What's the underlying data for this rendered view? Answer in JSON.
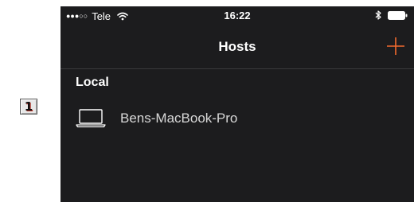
{
  "annotation": {
    "step_number": "1"
  },
  "status_bar": {
    "carrier": "Tele",
    "signal_dots": "●●●○○",
    "time": "16:22",
    "icons": [
      "wifi-icon",
      "bluetooth-icon",
      "battery-icon"
    ]
  },
  "nav": {
    "title": "Hosts",
    "add_icon": "plus-icon"
  },
  "sections": [
    {
      "header": "Local",
      "items": [
        {
          "icon": "laptop-icon",
          "label": "Bens-MacBook-Pro"
        }
      ]
    }
  ],
  "colors": {
    "background": "#1c1c1e",
    "accent": "#f26a2e",
    "text": "#ffffff",
    "secondary_text": "#d8d8d8"
  }
}
